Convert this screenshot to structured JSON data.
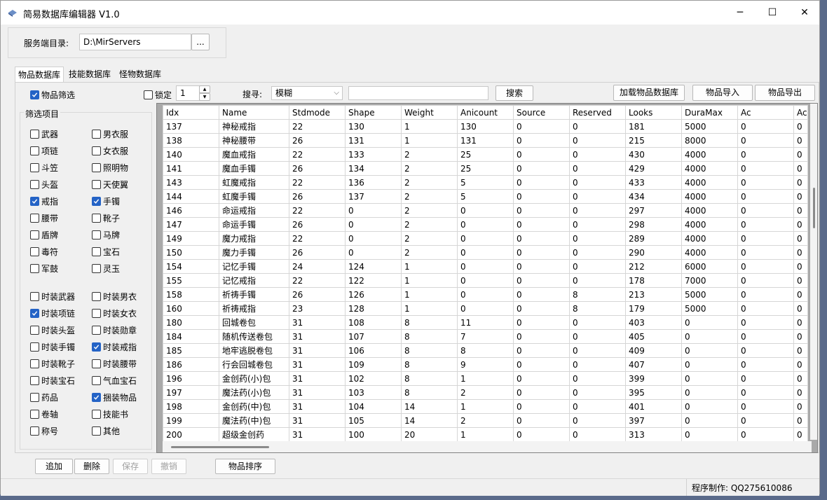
{
  "window": {
    "title": "简易数据库编辑器 V1.0",
    "minimize": "─",
    "maximize": "☐",
    "close": "✕"
  },
  "server": {
    "label": "服务端目录:",
    "path": "D:\\MirServers",
    "browse": "..."
  },
  "tabs": [
    "物品数据库",
    "技能数据库",
    "怪物数据库"
  ],
  "toolbar": {
    "item_filter": {
      "label": "物品筛选",
      "checked": true
    },
    "lock": {
      "label": "锁定",
      "checked": false,
      "value": "1"
    },
    "search_label": "搜寻:",
    "search_mode": "模糊",
    "search_value": "",
    "search_button": "搜索",
    "load_button": "加载物品数据库",
    "import_button": "物品导入",
    "export_button": "物品导出"
  },
  "filter": {
    "title": "筛选项目",
    "items": [
      {
        "label": "武器",
        "checked": false
      },
      {
        "label": "男衣服",
        "checked": false
      },
      {
        "label": "项链",
        "checked": false
      },
      {
        "label": "女衣服",
        "checked": false
      },
      {
        "label": "斗笠",
        "checked": false
      },
      {
        "label": "照明物",
        "checked": false
      },
      {
        "label": "头盔",
        "checked": false
      },
      {
        "label": "天使翼",
        "checked": false
      },
      {
        "label": "戒指",
        "checked": true
      },
      {
        "label": "手镯",
        "checked": true
      },
      {
        "label": "腰带",
        "checked": false
      },
      {
        "label": "靴子",
        "checked": false
      },
      {
        "label": "盾牌",
        "checked": false
      },
      {
        "label": "马牌",
        "checked": false
      },
      {
        "label": "毒符",
        "checked": false
      },
      {
        "label": "宝石",
        "checked": false
      },
      {
        "label": "军鼓",
        "checked": false
      },
      {
        "label": "灵玉",
        "checked": false
      }
    ],
    "items2": [
      {
        "label": "时装武器",
        "checked": false
      },
      {
        "label": "时装男衣",
        "checked": false
      },
      {
        "label": "时装项链",
        "checked": true
      },
      {
        "label": "时装女衣",
        "checked": false
      },
      {
        "label": "时装头盔",
        "checked": false
      },
      {
        "label": "时装勋章",
        "checked": false
      },
      {
        "label": "时装手镯",
        "checked": false
      },
      {
        "label": "时装戒指",
        "checked": true
      },
      {
        "label": "时装靴子",
        "checked": false
      },
      {
        "label": "时装腰带",
        "checked": false
      },
      {
        "label": "时装宝石",
        "checked": false
      },
      {
        "label": "气血宝石",
        "checked": false
      },
      {
        "label": "药品",
        "checked": false
      },
      {
        "label": "捆装物品",
        "checked": true
      },
      {
        "label": "卷轴",
        "checked": false
      },
      {
        "label": "技能书",
        "checked": false
      },
      {
        "label": "称号",
        "checked": false
      },
      {
        "label": "其他",
        "checked": false
      }
    ]
  },
  "grid": {
    "columns": [
      "Idx",
      "Name",
      "Stdmode",
      "Shape",
      "Weight",
      "Anicount",
      "Source",
      "Reserved",
      "Looks",
      "DuraMax",
      "Ac",
      "Ac"
    ],
    "rows": [
      [
        "137",
        "神秘戒指",
        "22",
        "130",
        "1",
        "130",
        "0",
        "0",
        "181",
        "5000",
        "0",
        "0"
      ],
      [
        "138",
        "神秘腰带",
        "26",
        "131",
        "1",
        "131",
        "0",
        "0",
        "215",
        "8000",
        "0",
        "0"
      ],
      [
        "140",
        "魔血戒指",
        "22",
        "133",
        "2",
        "25",
        "0",
        "0",
        "430",
        "4000",
        "0",
        "0"
      ],
      [
        "141",
        "魔血手镯",
        "26",
        "134",
        "2",
        "25",
        "0",
        "0",
        "429",
        "4000",
        "0",
        "0"
      ],
      [
        "143",
        "虹魔戒指",
        "22",
        "136",
        "2",
        "5",
        "0",
        "0",
        "433",
        "4000",
        "0",
        "0"
      ],
      [
        "144",
        "虹魔手镯",
        "26",
        "137",
        "2",
        "5",
        "0",
        "0",
        "434",
        "4000",
        "0",
        "0"
      ],
      [
        "146",
        "命运戒指",
        "22",
        "0",
        "2",
        "0",
        "0",
        "0",
        "297",
        "4000",
        "0",
        "0"
      ],
      [
        "147",
        "命运手镯",
        "26",
        "0",
        "2",
        "0",
        "0",
        "0",
        "298",
        "4000",
        "0",
        "0"
      ],
      [
        "149",
        "魔力戒指",
        "22",
        "0",
        "2",
        "0",
        "0",
        "0",
        "289",
        "4000",
        "0",
        "0"
      ],
      [
        "150",
        "魔力手镯",
        "26",
        "0",
        "2",
        "0",
        "0",
        "0",
        "290",
        "4000",
        "0",
        "0"
      ],
      [
        "154",
        "记忆手镯",
        "24",
        "124",
        "1",
        "0",
        "0",
        "0",
        "212",
        "6000",
        "0",
        "0"
      ],
      [
        "155",
        "记忆戒指",
        "22",
        "122",
        "1",
        "0",
        "0",
        "0",
        "178",
        "7000",
        "0",
        "0"
      ],
      [
        "158",
        "祈祷手镯",
        "26",
        "126",
        "1",
        "0",
        "0",
        "8",
        "213",
        "5000",
        "0",
        "0"
      ],
      [
        "160",
        "祈祷戒指",
        "23",
        "128",
        "1",
        "0",
        "0",
        "8",
        "179",
        "5000",
        "0",
        "0"
      ],
      [
        "180",
        "回城卷包",
        "31",
        "108",
        "8",
        "11",
        "0",
        "0",
        "403",
        "0",
        "0",
        "0"
      ],
      [
        "184",
        "随机传送卷包",
        "31",
        "107",
        "8",
        "7",
        "0",
        "0",
        "405",
        "0",
        "0",
        "0"
      ],
      [
        "185",
        "地牢逃脱卷包",
        "31",
        "106",
        "8",
        "8",
        "0",
        "0",
        "409",
        "0",
        "0",
        "0"
      ],
      [
        "186",
        "行会回城卷包",
        "31",
        "109",
        "8",
        "9",
        "0",
        "0",
        "407",
        "0",
        "0",
        "0"
      ],
      [
        "196",
        "金创药(小)包",
        "31",
        "102",
        "8",
        "1",
        "0",
        "0",
        "399",
        "0",
        "0",
        "0"
      ],
      [
        "197",
        "魔法药(小)包",
        "31",
        "103",
        "8",
        "2",
        "0",
        "0",
        "395",
        "0",
        "0",
        "0"
      ],
      [
        "198",
        "金创药(中)包",
        "31",
        "104",
        "14",
        "1",
        "0",
        "0",
        "401",
        "0",
        "0",
        "0"
      ],
      [
        "199",
        "魔法药(中)包",
        "31",
        "105",
        "14",
        "2",
        "0",
        "0",
        "397",
        "0",
        "0",
        "0"
      ],
      [
        "200",
        "超级金创药",
        "31",
        "100",
        "20",
        "1",
        "0",
        "0",
        "313",
        "0",
        "0",
        "0"
      ]
    ]
  },
  "actions": {
    "add": "追加",
    "delete": "删除",
    "save": "保存",
    "undo": "撤销",
    "sort": "物品排序"
  },
  "status": {
    "author": "程序制作: QQ275610086"
  }
}
